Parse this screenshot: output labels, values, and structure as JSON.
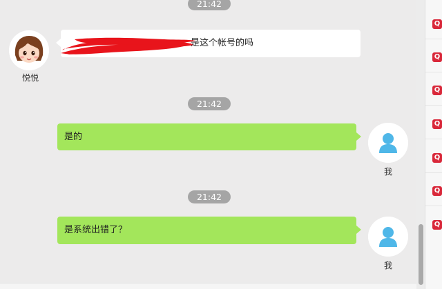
{
  "messages": [
    {
      "time": "21:42",
      "sender": "悦悦",
      "text": "是这个帐号的吗",
      "side": "left"
    },
    {
      "time": "21:42",
      "sender": "我",
      "text": "是的",
      "side": "right"
    },
    {
      "time": "21:42",
      "sender": "我",
      "text": "是系统出错了？",
      "side": "right"
    }
  ],
  "top_time": "21:42",
  "side_icons": [
    "Q",
    "Q",
    "Q",
    "Q",
    "Q",
    "Q",
    "Q"
  ],
  "colors": {
    "bubble_self": "#a3e65b",
    "bubble_other": "#ffffff",
    "timestamp_bg": "#a5a5a5",
    "redaction": "#e8141b",
    "q_icon": "#d9283a"
  }
}
